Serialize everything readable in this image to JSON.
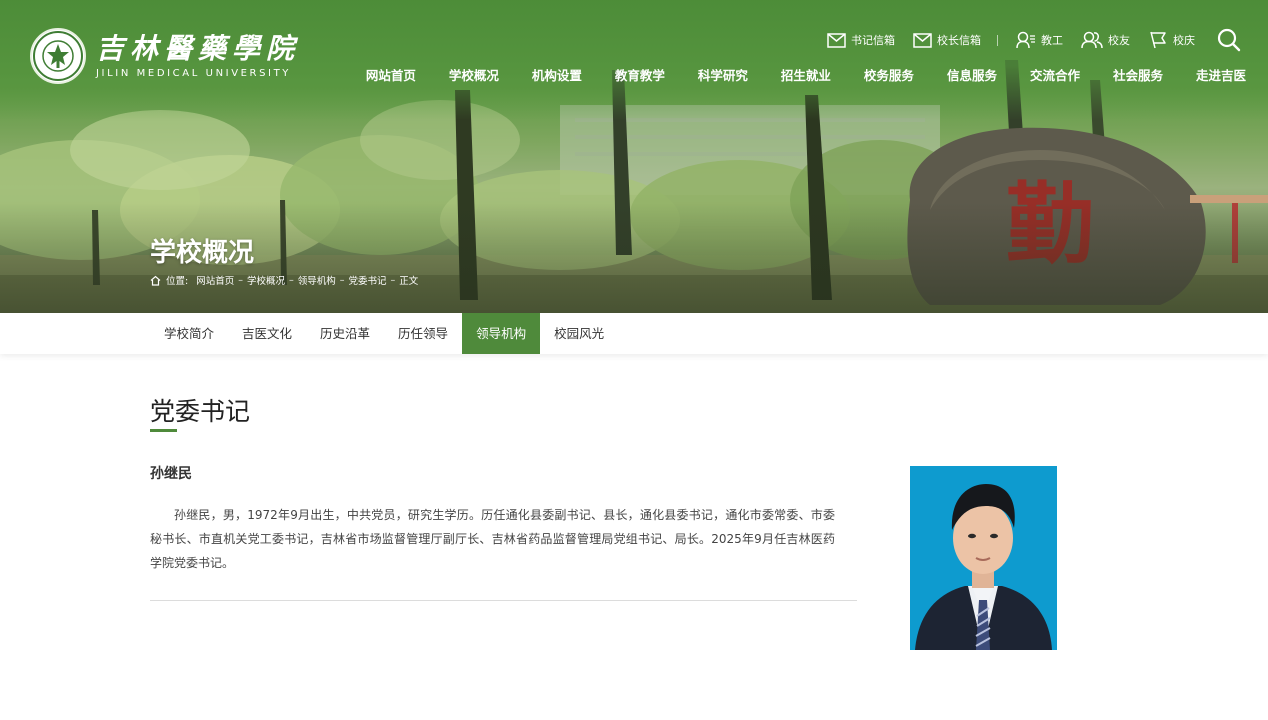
{
  "site": {
    "logo_cn": "吉林醫藥學院",
    "logo_en": "JILIN MEDICAL UNIVERSITY",
    "logo_emblem_text": "JILIN MEDICAL UNIVERSITY"
  },
  "utility_links": [
    {
      "label": "书记信箱",
      "icon": "mail-icon"
    },
    {
      "label": "校长信箱",
      "icon": "mail-icon"
    },
    {
      "label": "教工",
      "icon": "staff-icon"
    },
    {
      "label": "校友",
      "icon": "alumni-icon"
    },
    {
      "label": "校庆",
      "icon": "flag-icon"
    }
  ],
  "search": {
    "icon": "search-icon"
  },
  "main_nav": [
    "网站首页",
    "学校概况",
    "机构设置",
    "教育教学",
    "科学研究",
    "招生就业",
    "校务服务",
    "信息服务",
    "交流合作",
    "社会服务",
    "走进吉医"
  ],
  "banner": {
    "title": "学校概况",
    "stone_character": "勤"
  },
  "breadcrumb": {
    "label": "位置:",
    "items": [
      "网站首页",
      "学校概况",
      "领导机构",
      "党委书记",
      "正文"
    ],
    "separator": "–"
  },
  "sub_nav": {
    "items": [
      "学校简介",
      "吉医文化",
      "历史沿革",
      "历任领导",
      "领导机构",
      "校园风光"
    ],
    "active_index": 4
  },
  "article": {
    "title": "党委书记",
    "person_name": "孙继民",
    "bio": "孙继民，男，1972年9月出生，中共党员，研究生学历。历任通化县委副书记、县长，通化县委书记，通化市委常委、市委秘书长、市直机关党工委书记，吉林省市场监督管理厅副厅长、吉林省药品监督管理局党组书记、局长。2025年9月任吉林医药学院党委书记。"
  },
  "colors": {
    "brand_green": "#4f8a3b",
    "banner_green": "#5b963f",
    "portrait_bg": "#0e9bcf"
  }
}
